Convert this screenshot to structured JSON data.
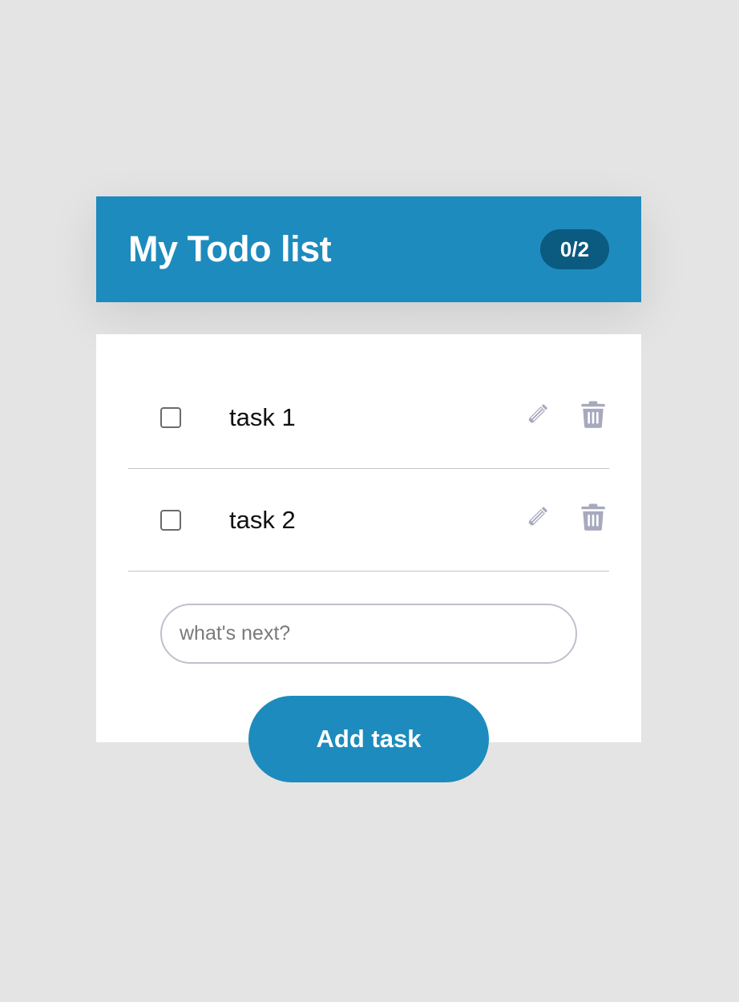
{
  "header": {
    "title": "My Todo list",
    "counter": "0/2"
  },
  "tasks": [
    {
      "label": "task 1",
      "completed": false
    },
    {
      "label": "task 2",
      "completed": false
    }
  ],
  "icons": {
    "edit": "pencil-icon",
    "delete": "trash-icon",
    "color": "#a7a9bd"
  },
  "new_task": {
    "value": "",
    "placeholder": "what's next?"
  },
  "add_button": {
    "label": "Add task"
  },
  "colors": {
    "accent": "#1d8bbd",
    "badge": "#0b5a80",
    "background": "#e4e4e4",
    "divider": "#c4c4cc"
  }
}
